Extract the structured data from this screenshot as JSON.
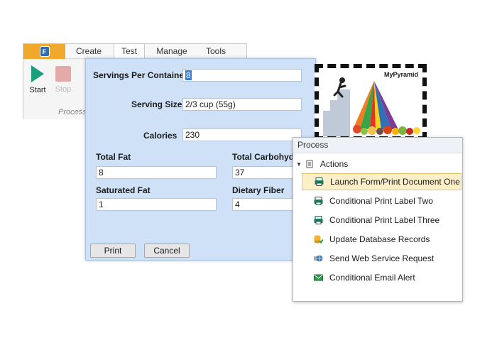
{
  "ribbon": {
    "tabs": [
      "Create",
      "Test",
      "Manage",
      "Tools"
    ],
    "active_tab": "Test",
    "start_label": "Start",
    "stop_label": "Stop",
    "group_label": "Process"
  },
  "form": {
    "servings_label": "Servings Per Container",
    "servings_value": "8",
    "serving_size_label": "Serving Size",
    "serving_size_value": "2/3 cup (55g)",
    "calories_label": "Calories",
    "calories_value": "230",
    "total_fat_label": "Total Fat",
    "total_fat_value": "8",
    "total_carb_label": "Total Carbohydr",
    "total_carb_value": "37",
    "sat_fat_label": "Saturated Fat",
    "sat_fat_value": "1",
    "fiber_label": "Dietary Fiber",
    "fiber_value": "4",
    "print_label": "Print",
    "cancel_label": "Cancel",
    "poster_title": "MyPyramid"
  },
  "process": {
    "header": "Process",
    "group_label": "Actions",
    "items": [
      {
        "label": "Launch Form/Print Document One",
        "icon": "printer-icon"
      },
      {
        "label": "Conditional Print Label Two",
        "icon": "printer-icon"
      },
      {
        "label": "Conditional Print Label Three",
        "icon": "printer-icon"
      },
      {
        "label": "Update Database Records",
        "icon": "database-update-icon"
      },
      {
        "label": "Send Web Service Request",
        "icon": "web-service-icon"
      },
      {
        "label": "Conditional Email Alert",
        "icon": "email-icon"
      }
    ],
    "selected_index": 0
  },
  "colors": {
    "accent": "#f0a92b",
    "form_bg": "#cfe1f6",
    "play": "#1a9e7e",
    "selection": "#fdf0c8"
  }
}
